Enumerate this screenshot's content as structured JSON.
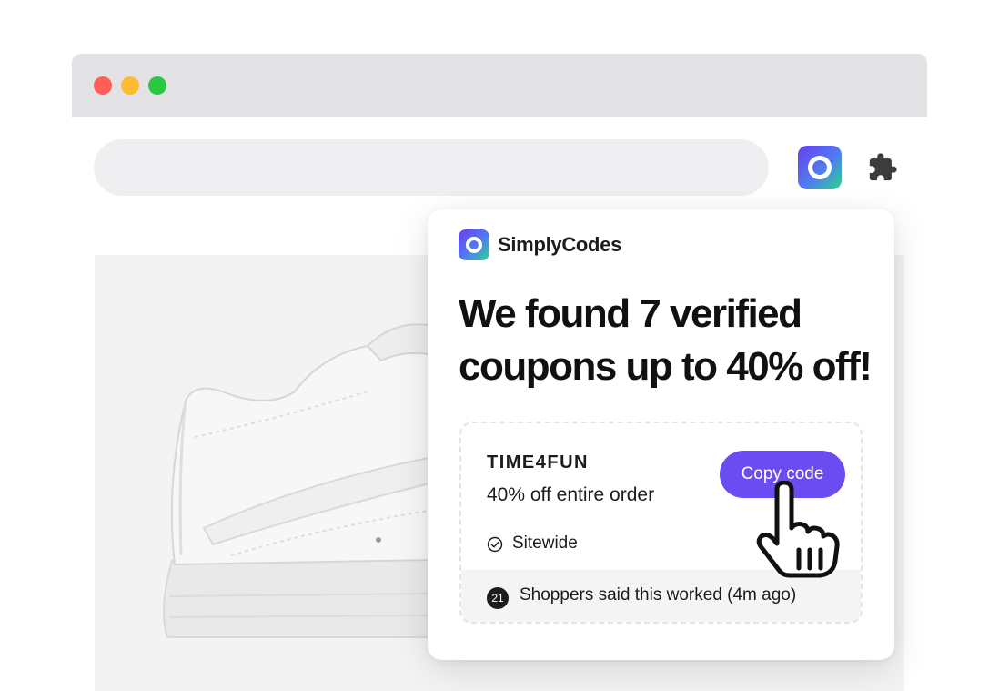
{
  "toolbar": {
    "extension_icon": "simplycodes-logo-icon",
    "extensions_menu_icon": "puzzle-icon"
  },
  "popup": {
    "brand_name": "SimplyCodes",
    "headline": "We found 7 verified coupons up to 40% off!",
    "coupon": {
      "code": "TIME4FUN",
      "description": "40% off entire order",
      "scope": "Sitewide",
      "copy_button_label": "Copy code",
      "shopper_count": "21",
      "social_proof": "Shoppers said this worked (4m ago)"
    }
  },
  "colors": {
    "accent": "#6a4cf0",
    "window_red": "#fe5f57",
    "window_yellow": "#febc2e",
    "window_green": "#28c840"
  }
}
